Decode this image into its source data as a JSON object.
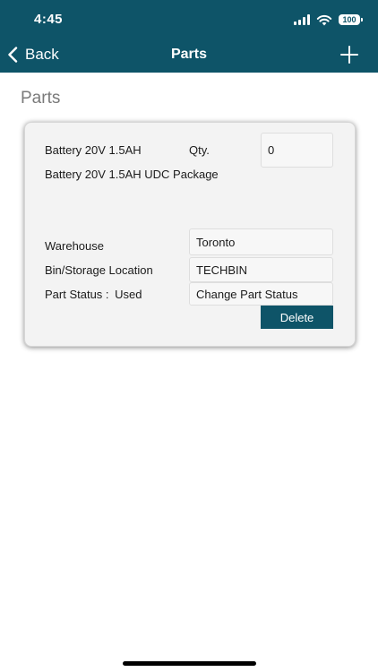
{
  "status_bar": {
    "time": "4:45",
    "battery": "100"
  },
  "nav": {
    "back_label": "Back",
    "title": "Parts",
    "add_icon": "plus-icon"
  },
  "page": {
    "heading": "Parts"
  },
  "part": {
    "name": "Battery 20V 1.5AH",
    "qty_label": "Qty.",
    "qty_value": "0",
    "description": "Battery 20V 1.5AH UDC Package",
    "warehouse_label": "Warehouse",
    "warehouse_value": "Toronto",
    "bin_label": "Bin/Storage Location",
    "bin_value": "TECHBIN",
    "status_label": "Part Status :",
    "status_value": "Used",
    "change_status_label": "Change Part Status",
    "delete_label": "Delete"
  },
  "colors": {
    "brand": "#0e5468",
    "card_bg": "#f3f3f3",
    "heading_gray": "#7a7a7a"
  }
}
